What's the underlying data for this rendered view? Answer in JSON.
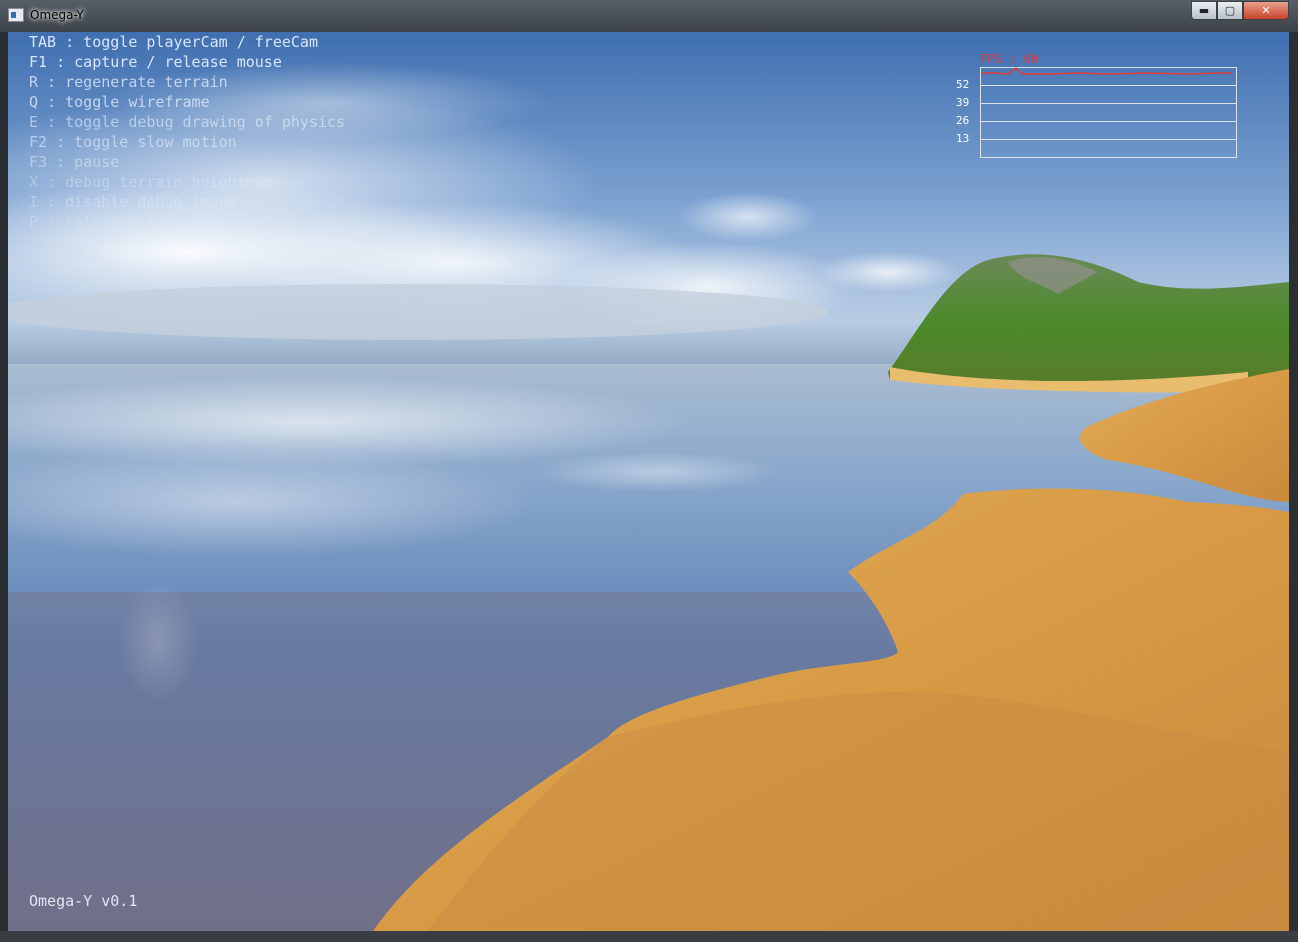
{
  "window": {
    "title": "Omega-Y",
    "buttons": {
      "minimize": "▬",
      "maximize": "▢",
      "close": "✕"
    }
  },
  "help_lines": [
    "TAB : toggle playerCam / freeCam",
    "F1 : capture / release mouse",
    "R : regenerate terrain",
    "Q : toggle wireframe",
    "E : toggle debug drawing of physics",
    "F2 : toggle slow motion",
    "F3 : pause",
    "X : debug terrain heightmap",
    "I : disable debug image",
    "P : reload all shaders"
  ],
  "version": "Omega-Y v0.1",
  "fps": {
    "label": "FPS : 60",
    "ticks": [
      "52",
      "39",
      "26",
      "13"
    ],
    "color": "#e03a3a"
  },
  "colors": {
    "sky_top": "#4a78b5",
    "sea": "#4f7fc4",
    "sand": "#d9a24e",
    "grass": "#4f8a2c"
  }
}
